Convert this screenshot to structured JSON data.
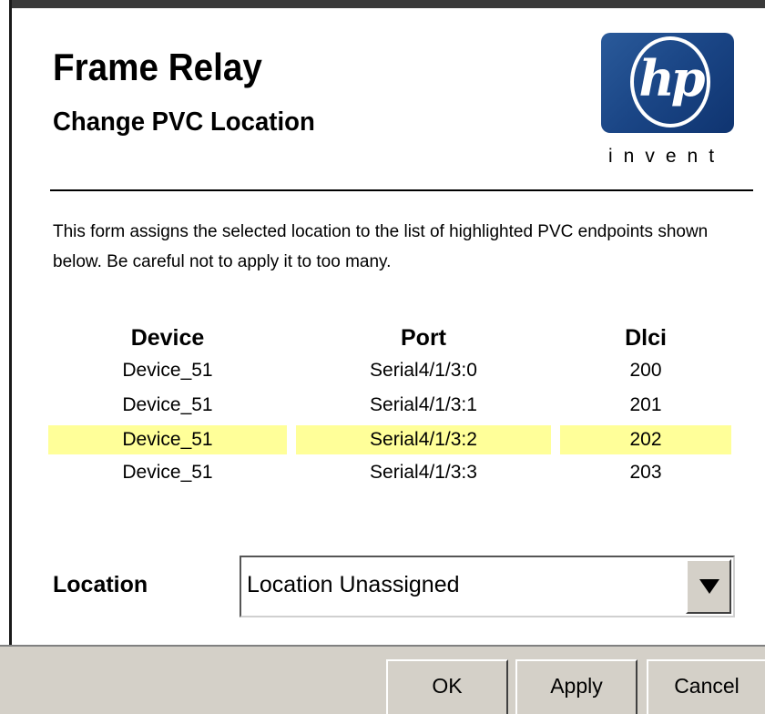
{
  "header": {
    "title": "Frame Relay",
    "subtitle": "Change PVC Location"
  },
  "logo": {
    "mark": "hp",
    "tagline": "invent",
    "color": "#1a4585"
  },
  "description": "This form assigns the selected location to the list of highlighted PVC endpoints shown below. Be careful not to apply it to too many.",
  "table": {
    "headers": [
      "Device",
      "Port",
      "Dlci"
    ],
    "rows": [
      {
        "device": "Device_51",
        "port": "Serial4/1/3:0",
        "dlci": "200",
        "highlighted": false
      },
      {
        "device": "Device_51",
        "port": "Serial4/1/3:1",
        "dlci": "201",
        "highlighted": false
      },
      {
        "device": "Device_51",
        "port": "Serial4/1/3:2",
        "dlci": "202",
        "highlighted": true
      },
      {
        "device": "Device_51",
        "port": "Serial4/1/3:3",
        "dlci": "203",
        "highlighted": false
      }
    ],
    "highlight_color": "#ffff99"
  },
  "location": {
    "label": "Location",
    "selected": "Location Unassigned",
    "arrow_icon": "chevron-down-icon"
  },
  "buttons": {
    "ok": "OK",
    "apply": "Apply",
    "cancel": "Cancel"
  }
}
